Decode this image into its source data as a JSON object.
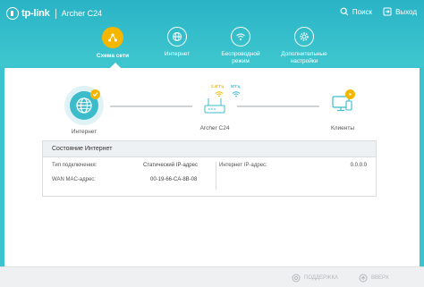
{
  "header": {
    "brand": "tp-link",
    "model": "Archer C24",
    "search_label": "Поиск",
    "logout_label": "Выход"
  },
  "nav": {
    "items": [
      {
        "label": "Схема сети",
        "icon": "network-map-icon",
        "active": true
      },
      {
        "label": "Интернет",
        "icon": "globe-icon",
        "active": false
      },
      {
        "label": "Беспроводной режим",
        "icon": "wifi-icon",
        "active": false
      },
      {
        "label": "Дополнительные настройки",
        "icon": "gear-icon",
        "active": false
      }
    ]
  },
  "topology": {
    "internet_label": "Интернет",
    "router_label": "Archer C24",
    "clients_label": "Клиенты",
    "band_24": "2.4ГГц",
    "band_5": "5ГГц"
  },
  "status_card": {
    "title": "Состояние Интернет",
    "connection_type_label": "Тип подключения:",
    "connection_type_value": "Статический IP-адрес",
    "mac_label": "WAN MAC-адрес:",
    "mac_value": "00-19-66-CA-8B-08",
    "ip_label": "Интернет IP-адрес:",
    "ip_value": "0.0.0.0"
  },
  "footer": {
    "support_label": "ПОДДЕРЖКА",
    "top_label": "ВВЕРХ"
  },
  "colors": {
    "accent": "#3cc3cf",
    "active": "#f5b600",
    "band_24": "#f5b600",
    "band_5": "#3cbccb"
  }
}
